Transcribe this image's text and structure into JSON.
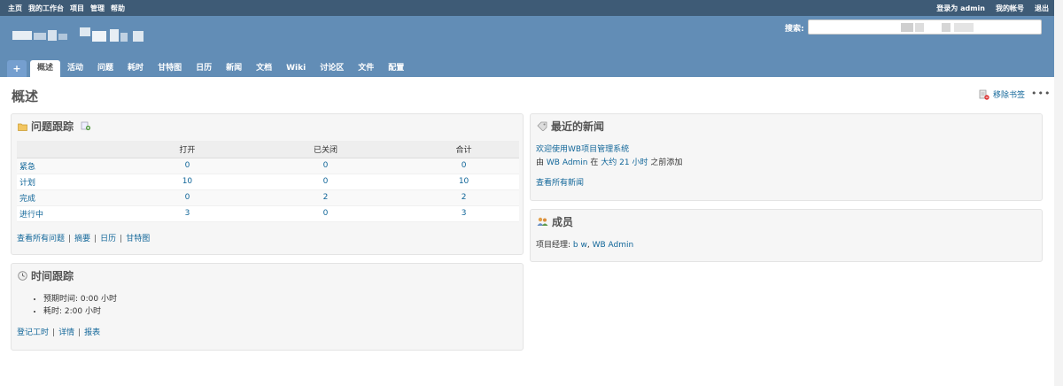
{
  "top_menu": {
    "items": [
      "主页",
      "我的工作台",
      "项目",
      "管理",
      "帮助"
    ],
    "login_prefix": "登录为",
    "user": "admin",
    "account": "我的帐号",
    "logout": "退出"
  },
  "header": {
    "search_label": "搜索:"
  },
  "main_menu": {
    "add": "+",
    "tabs": [
      "概述",
      "活动",
      "问题",
      "耗时",
      "甘特图",
      "日历",
      "新闻",
      "文档",
      "Wiki",
      "讨论区",
      "文件",
      "配置"
    ]
  },
  "page": {
    "title": "概述",
    "bookmark": "移除书签",
    "more": "•••"
  },
  "issues": {
    "title": "问题跟踪",
    "headers": [
      "",
      "打开",
      "已关闭",
      "合计"
    ],
    "rows": [
      {
        "name": "紧急",
        "open": "0",
        "closed": "0",
        "total": "0"
      },
      {
        "name": "计划",
        "open": "10",
        "closed": "0",
        "total": "10"
      },
      {
        "name": "完成",
        "open": "0",
        "closed": "2",
        "total": "2"
      },
      {
        "name": "进行中",
        "open": "3",
        "closed": "0",
        "total": "3"
      }
    ],
    "links": [
      "查看所有问题",
      "摘要",
      "日历",
      "甘特图"
    ]
  },
  "time": {
    "title": "时间跟踪",
    "items": [
      "预期时间: 0:00 小时",
      "耗时: 2:00 小时"
    ],
    "links": [
      "登记工时",
      "详情",
      "报表"
    ]
  },
  "news": {
    "title": "最近的新闻",
    "item_title": "欢迎使用WB项目管理系统",
    "by": "由",
    "author": "WB Admin",
    "at": "在",
    "when": "大约 21 小时",
    "suffix": "之前添加",
    "all": "查看所有新闻"
  },
  "members": {
    "title": "成员",
    "role": "项目经理:",
    "names": [
      "b w",
      "WB Admin"
    ]
  },
  "colors": {
    "top_bar": "#3e5b76",
    "header": "#628db6",
    "link": "#116699"
  }
}
